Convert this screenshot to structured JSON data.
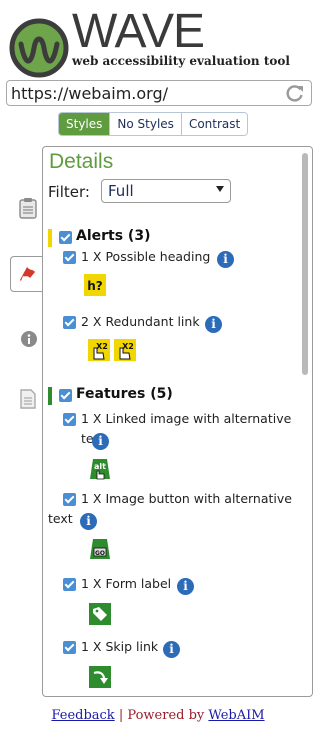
{
  "header": {
    "brand": "WAVE",
    "tagline": "web accessibility evaluation tool",
    "logo_icon": "wave-logo-icon"
  },
  "url_bar": {
    "value": "https://webaim.org/",
    "refresh_icon": "refresh-icon"
  },
  "view_toggles": [
    {
      "label": "Styles",
      "active": true
    },
    {
      "label": "No Styles",
      "active": false
    },
    {
      "label": "Contrast",
      "active": false
    }
  ],
  "side_tabs": [
    {
      "icon": "clipboard-icon",
      "active": false
    },
    {
      "icon": "flag-icon",
      "active": true
    },
    {
      "icon": "info-circle-icon",
      "active": false
    },
    {
      "icon": "document-icon",
      "active": false
    }
  ],
  "panel": {
    "title": "Details",
    "filter_label": "Filter:",
    "filter_value": "Full",
    "categories": [
      {
        "label": "Alerts (3)",
        "color": "#f2d600",
        "items": [
          {
            "label": "1 X Possible heading",
            "badges": [
              "h?"
            ]
          },
          {
            "label": "2 X Redundant link",
            "badges": [
              "x2",
              "x2"
            ]
          }
        ]
      },
      {
        "label": "Features (5)",
        "color": "#2e8b2e",
        "items": [
          {
            "label": "1 X Linked image with alternative text",
            "badges": [
              "alt"
            ]
          },
          {
            "label": "1 X Image button with alternative text",
            "badges": [
              "go"
            ]
          },
          {
            "label": "1 X Form label",
            "badges": [
              "tag"
            ]
          },
          {
            "label": "1 X Skip link",
            "badges": [
              "skip"
            ]
          }
        ]
      }
    ]
  },
  "footer": {
    "feedback": "Feedback",
    "separator": "|",
    "powered_by": "Powered by",
    "webaim": "WebAIM"
  },
  "colors": {
    "accent_green": "#5f9b3f",
    "alert_yellow": "#f2d600",
    "feature_green": "#2e8b2e",
    "info_blue": "#2c6bb8",
    "link_blue": "#1a1aa8",
    "footer_red": "#9b1c2b"
  }
}
